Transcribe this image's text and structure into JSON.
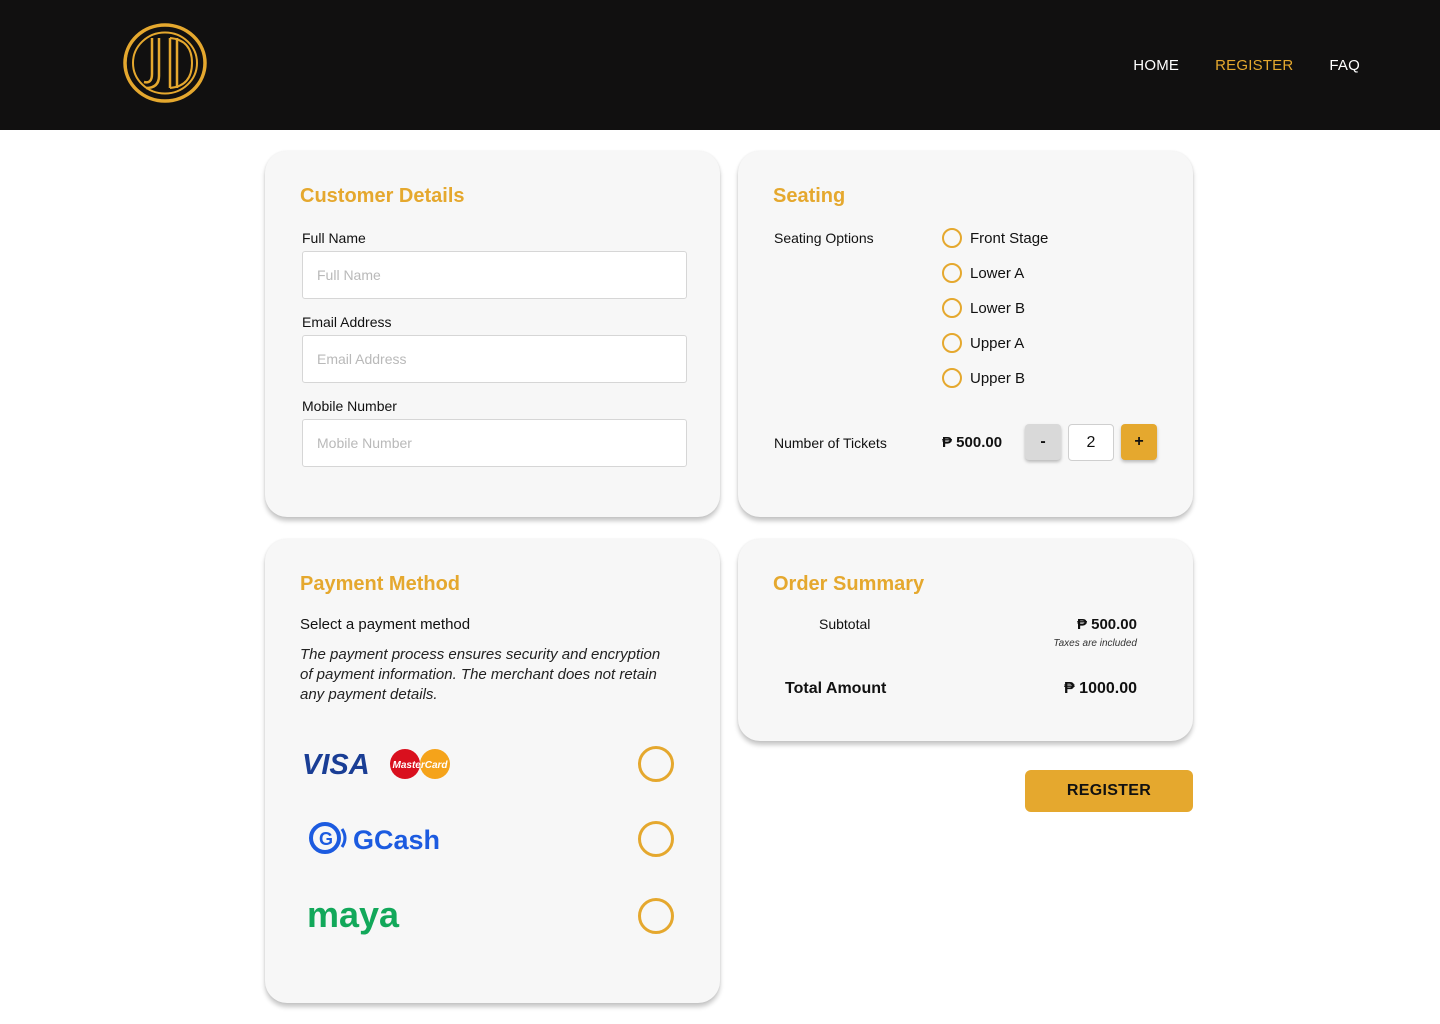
{
  "nav": {
    "home": "HOME",
    "register": "REGISTER",
    "faq": "FAQ"
  },
  "brand": {
    "accent": "#E5A82E",
    "header_bg": "#111010"
  },
  "customer": {
    "title": "Customer Details",
    "full_name_label": "Full Name",
    "full_name_placeholder": "Full Name",
    "email_label": "Email Address",
    "email_placeholder": "Email Address",
    "mobile_label": "Mobile Number",
    "mobile_placeholder": "Mobile Number"
  },
  "seating": {
    "title": "Seating",
    "options_label": "Seating Options",
    "options": [
      "Front Stage",
      "Lower A",
      "Lower B",
      "Upper A",
      "Upper B"
    ],
    "tickets_label": "Number of Tickets",
    "price": "₱ 500.00",
    "minus": "-",
    "plus": "+",
    "quantity": "2"
  },
  "payment": {
    "title": "Payment Method",
    "select_label": "Select a payment method",
    "note": "The payment process ensures security and encryption of payment information. The merchant does not retain any payment details.",
    "methods": [
      {
        "name": "visa-mastercard",
        "visa_text": "VISA",
        "mc_text": "MasterCard"
      },
      {
        "name": "gcash",
        "text": "GCash"
      },
      {
        "name": "maya",
        "text": "maya"
      }
    ]
  },
  "summary": {
    "title": "Order Summary",
    "subtotal_label": "Subtotal",
    "subtotal_value": "₱ 500.00",
    "tax_note": "Taxes are included",
    "total_label": "Total Amount",
    "total_value": "₱ 1000.00"
  },
  "register_button": "REGISTER"
}
